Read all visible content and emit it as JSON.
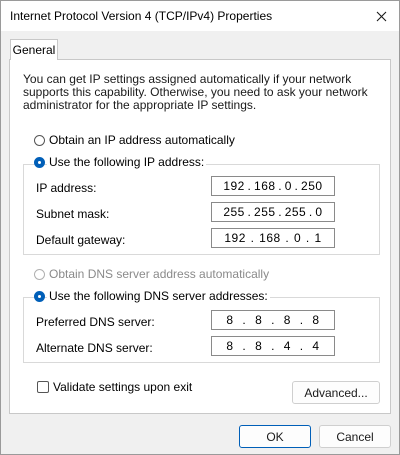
{
  "window": {
    "title": "Internet Protocol Version 4 (TCP/IPv4) Properties",
    "close_icon": "close-icon"
  },
  "tabs": [
    {
      "label": "General"
    }
  ],
  "description": "You can get IP settings assigned automatically if your network supports this capability. Otherwise, you need to ask your network administrator for the appropriate IP settings.",
  "ip": {
    "auto_label": "Obtain an IP address automatically",
    "manual_label": "Use the following IP address:",
    "selected": "manual",
    "fields": [
      {
        "label": "IP address:",
        "octets": [
          "192",
          "168",
          "0",
          "250"
        ]
      },
      {
        "label": "Subnet mask:",
        "octets": [
          "255",
          "255",
          "255",
          "0"
        ]
      },
      {
        "label": "Default gateway:",
        "octets": [
          "192",
          "168",
          "0",
          "1"
        ]
      }
    ]
  },
  "dns": {
    "auto_label": "Obtain DNS server address automatically",
    "auto_disabled": true,
    "manual_label": "Use the following DNS server addresses:",
    "selected": "manual",
    "fields": [
      {
        "label": "Preferred DNS server:",
        "octets": [
          "8",
          "8",
          "8",
          "8"
        ]
      },
      {
        "label": "Alternate DNS server:",
        "octets": [
          "8",
          "8",
          "4",
          "4"
        ]
      }
    ]
  },
  "validate": {
    "label": "Validate settings upon exit",
    "checked": false
  },
  "buttons": {
    "advanced": "Advanced...",
    "ok": "OK",
    "cancel": "Cancel"
  },
  "colors": {
    "accent": "#005fb8",
    "disabled_text": "#8a8a8a"
  }
}
